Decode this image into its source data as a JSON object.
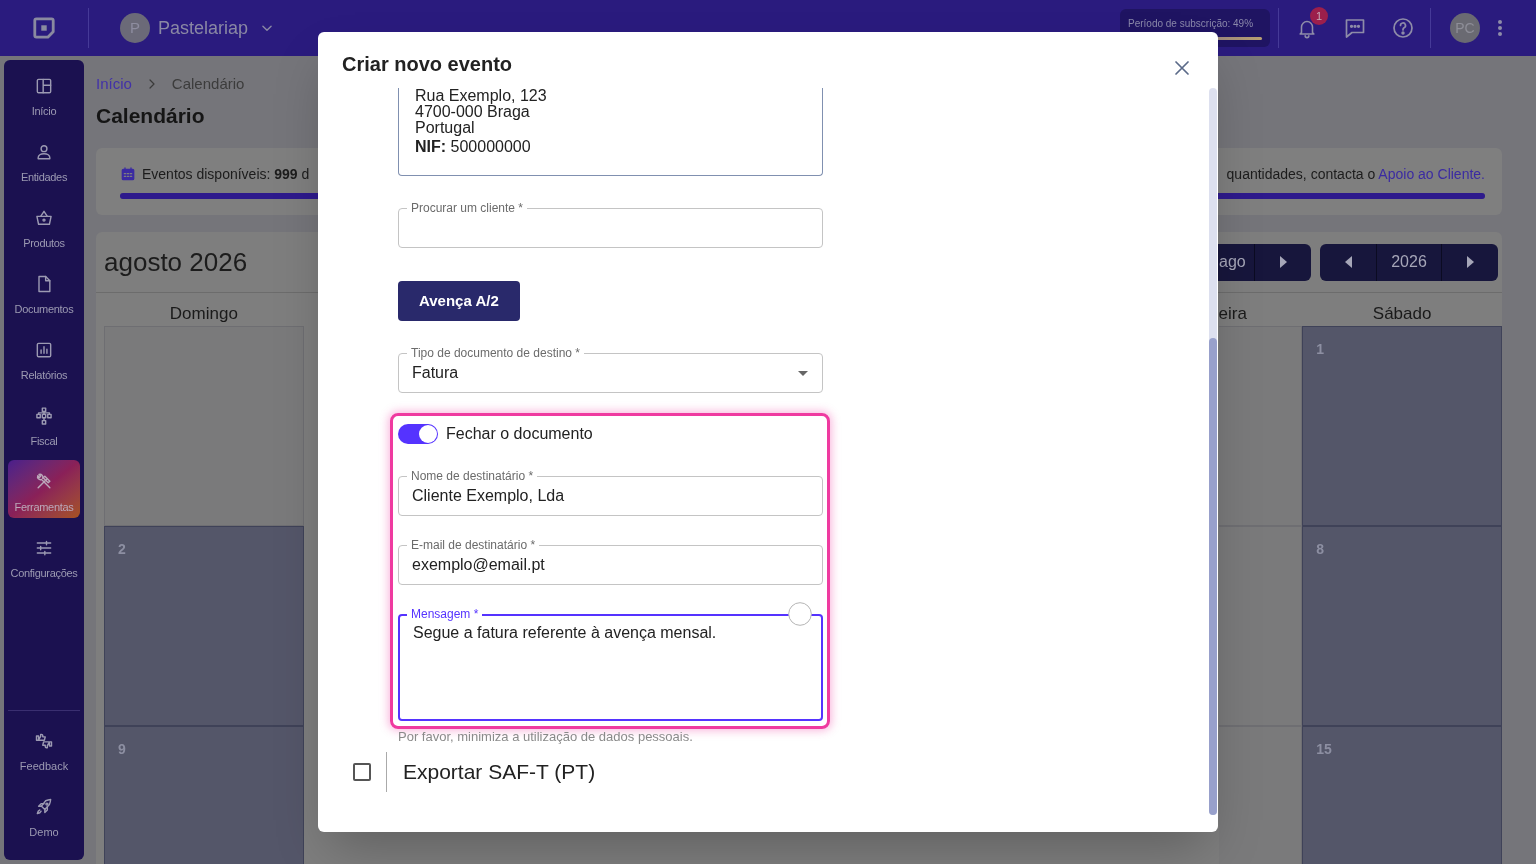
{
  "top_bar": {
    "company": {
      "initial": "P",
      "name": "Pastelariap"
    },
    "subscription": {
      "label": "Período de subscrição: 49%",
      "level": 1
    },
    "notifications": {
      "count": "1"
    },
    "user": {
      "initials": "PC"
    }
  },
  "sidebar": {
    "items": [
      {
        "label": "Início",
        "selected": false
      },
      {
        "label": "Entidades",
        "selected": false
      },
      {
        "label": "Produtos",
        "selected": false
      },
      {
        "label": "Documentos",
        "selected": false
      },
      {
        "label": "Relatórios",
        "selected": false
      },
      {
        "label": "Fiscal",
        "selected": false
      },
      {
        "label": "Ferramentas",
        "selected": true
      },
      {
        "label": "Configurações",
        "selected": false
      }
    ],
    "footer_items": [
      {
        "label": "Feedback"
      },
      {
        "label": "Demo"
      }
    ]
  },
  "breadcrumb": [
    {
      "label": "Início",
      "current": false
    },
    {
      "label": "Calendário",
      "current": true
    }
  ],
  "page_title": "Calendário",
  "events_banner": {
    "text_start": "Eventos disponíveis: **999** d",
    "text_end": "quantidades, contacta o",
    "link": "Apoio ao Cliente.",
    "level": 1
  },
  "calendar": {
    "title": "agosto 2026",
    "month_nav": {
      "label": "ago"
    },
    "year_nav": {
      "label": "2026"
    },
    "weekdays": [
      "Domingo",
      "eira",
      "Sábado"
    ],
    "weeks": [
      [
        {
          "highlighted": false
        },
        {
          "highlighted": false
        },
        {
          "day": "1",
          "highlighted": true
        }
      ],
      [
        {
          "day": "2",
          "highlighted": true
        },
        {
          "highlighted": false
        },
        {
          "day": "8",
          "highlighted": true
        }
      ],
      [
        {
          "day": "9",
          "highlighted": true
        },
        {
          "highlighted": false
        },
        {
          "day": "15",
          "highlighted": true
        }
      ]
    ]
  },
  "modal": {
    "title": "Criar novo evento",
    "address": {
      "lines": [
        "Rua Exemplo, 123",
        "4700-000 Braga",
        "Portugal"
      ],
      "nif": "**NIF:** 500000000"
    },
    "client_search": {
      "label": "Procurar um cliente *"
    },
    "contract_button": "Avença A/2",
    "document_type": {
      "label": "Tipo de documento de destino *",
      "value": "Fatura"
    },
    "close_document": {
      "label": "Fechar o documento",
      "on": true
    },
    "recipient_name": {
      "label": "Nome de destinatário *",
      "value": "Cliente Exemplo, Lda"
    },
    "recipient_email": {
      "label": "E-mail de destinatário *",
      "value": "exemplo@email.pt"
    },
    "message": {
      "label": "Mensagem *",
      "value": "Segue a fatura referente à avença mensal.",
      "focused": true
    },
    "hint": "Por favor, minimiza a utilização de dados pessoais.",
    "saft_export": {
      "label": "Exportar SAF-T (PT)",
      "checked": false
    }
  }
}
